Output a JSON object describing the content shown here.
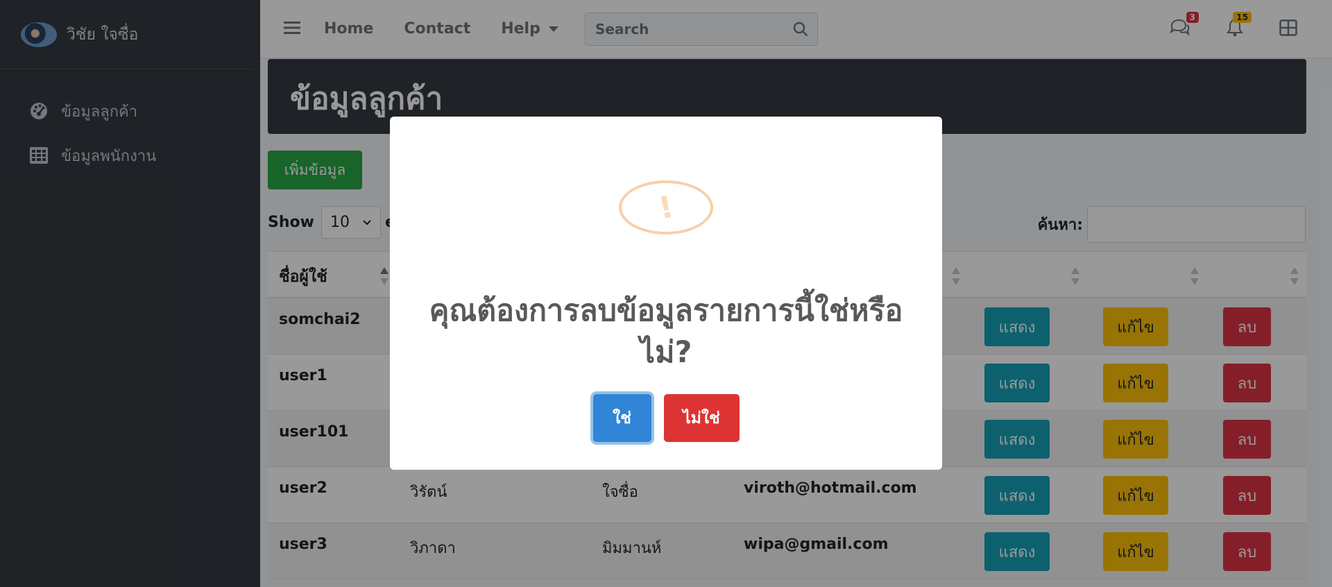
{
  "sidebar": {
    "user_name": "วิชัย ใจซื่อ",
    "items": [
      {
        "label": "ข้อมูลลูกค้า",
        "icon": "dashboard-gauge-icon"
      },
      {
        "label": "ข้อมูลพนักงาน",
        "icon": "table-grid-icon"
      }
    ]
  },
  "navbar": {
    "links": [
      "Home",
      "Contact",
      "Help"
    ],
    "search_placeholder": "Search",
    "messages_count": "3",
    "notifications_count": "15"
  },
  "page": {
    "title": "ข้อมูลลูกค้า",
    "add_button": "เพิ่มข้อมูล",
    "show_label": "Show",
    "page_length": "10",
    "entries_label": "en",
    "search_label": "ค้นหา:"
  },
  "table": {
    "header_username": "ชื่อผู้ใช้",
    "actions": {
      "show": "แสดง",
      "edit": "แก้ไข",
      "delete": "ลบ"
    },
    "rows": [
      {
        "username": "somchai2",
        "first": "",
        "last": "",
        "email": ""
      },
      {
        "username": "user1",
        "first": "",
        "last": "",
        "email": ""
      },
      {
        "username": "user101",
        "first": "",
        "last": "",
        "email": ""
      },
      {
        "username": "user2",
        "first": "วิรัตน์",
        "last": "ใจซื่อ",
        "email": "viroth@hotmail.com"
      },
      {
        "username": "user3",
        "first": "วิภาดา",
        "last": "มิมมานห์",
        "email": "wipa@gmail.com"
      }
    ]
  },
  "modal": {
    "icon": "warning-icon",
    "title": "คุณต้องการลบข้อมูลรายการนี้ใช่หรือไม่?",
    "confirm": "ใช่",
    "cancel": "ไม่ใช่"
  },
  "colors": {
    "sidebar": "#343a40",
    "success": "#28a745",
    "info": "#17a2b8",
    "warning": "#ffc107",
    "danger": "#dc3545",
    "confirm": "#3085d6",
    "cancel": "#dd3333"
  }
}
